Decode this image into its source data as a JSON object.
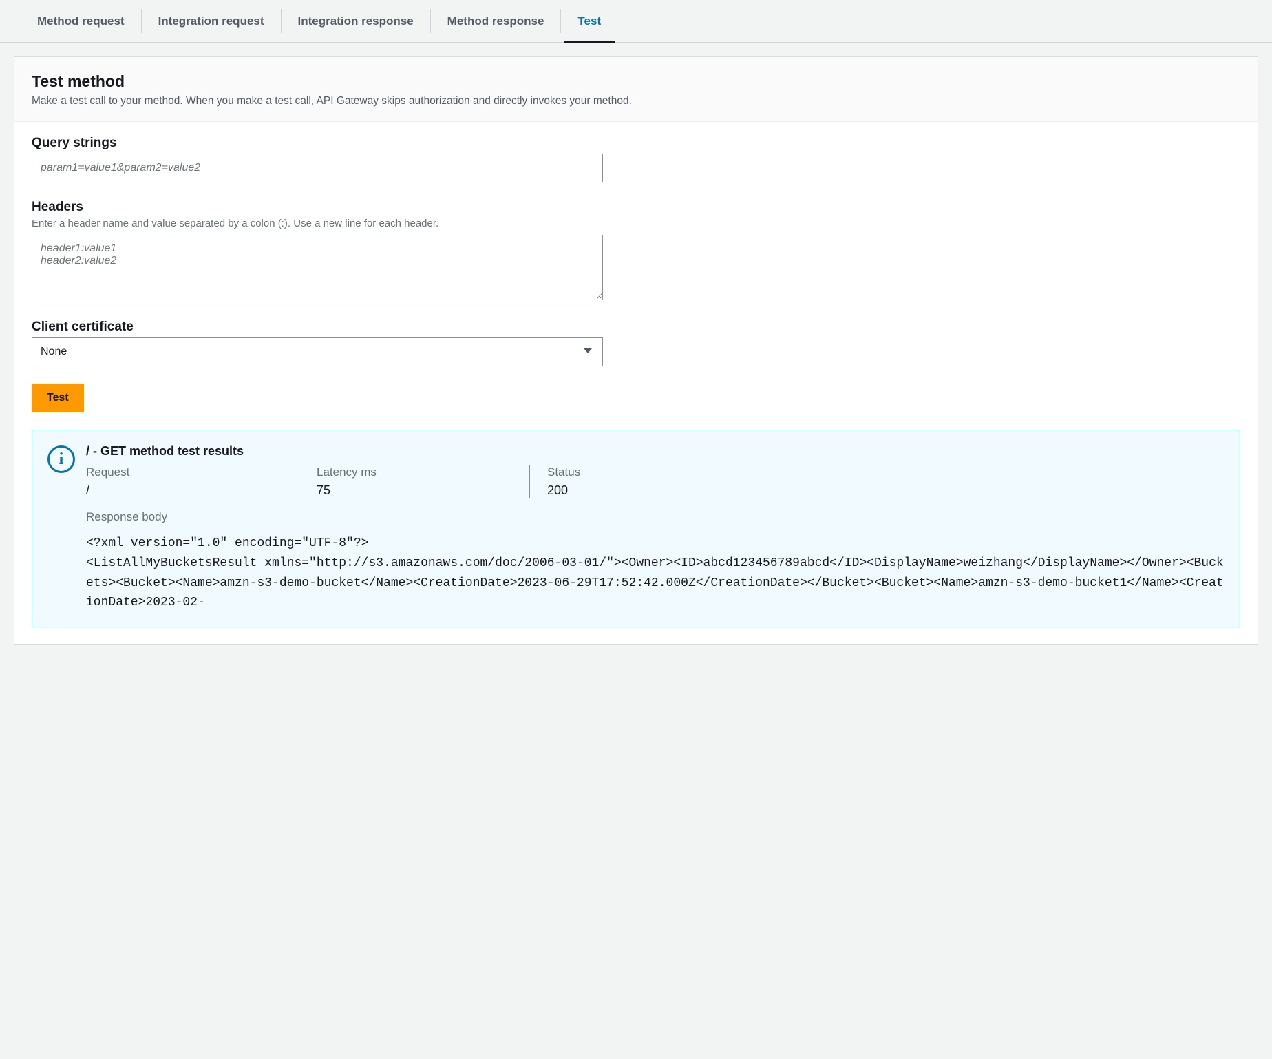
{
  "tabs": {
    "items": [
      {
        "label": "Method request",
        "active": false
      },
      {
        "label": "Integration request",
        "active": false
      },
      {
        "label": "Integration response",
        "active": false
      },
      {
        "label": "Method response",
        "active": false
      },
      {
        "label": "Test",
        "active": true
      }
    ]
  },
  "panel": {
    "title": "Test method",
    "description": "Make a test call to your method. When you make a test call, API Gateway skips authorization and directly invokes your method."
  },
  "fields": {
    "query_strings": {
      "label": "Query strings",
      "placeholder": "param1=value1&param2=value2",
      "value": ""
    },
    "headers": {
      "label": "Headers",
      "hint": "Enter a header name and value separated by a colon (:). Use a new line for each header.",
      "placeholder": "header1:value1\nheader2:value2",
      "value": ""
    },
    "client_certificate": {
      "label": "Client certificate",
      "selected": "None"
    }
  },
  "actions": {
    "test_button": "Test"
  },
  "results": {
    "title": "/ - GET method test results",
    "request": {
      "label": "Request",
      "value": "/"
    },
    "latency": {
      "label": "Latency ms",
      "value": "75"
    },
    "status": {
      "label": "Status",
      "value": "200"
    },
    "response_body_label": "Response body",
    "response_body": "<?xml version=\"1.0\" encoding=\"UTF-8\"?>\n<ListAllMyBucketsResult xmlns=\"http://s3.amazonaws.com/doc/2006-03-01/\"><Owner><ID>abcd123456789abcd</ID><DisplayName>weizhang</DisplayName></Owner><Buckets><Bucket><Name>amzn-s3-demo-bucket</Name><CreationDate>2023-06-29T17:52:42.000Z</CreationDate></Bucket><Bucket><Name>amzn-s3-demo-bucket1</Name><CreationDate>2023-02-"
  }
}
